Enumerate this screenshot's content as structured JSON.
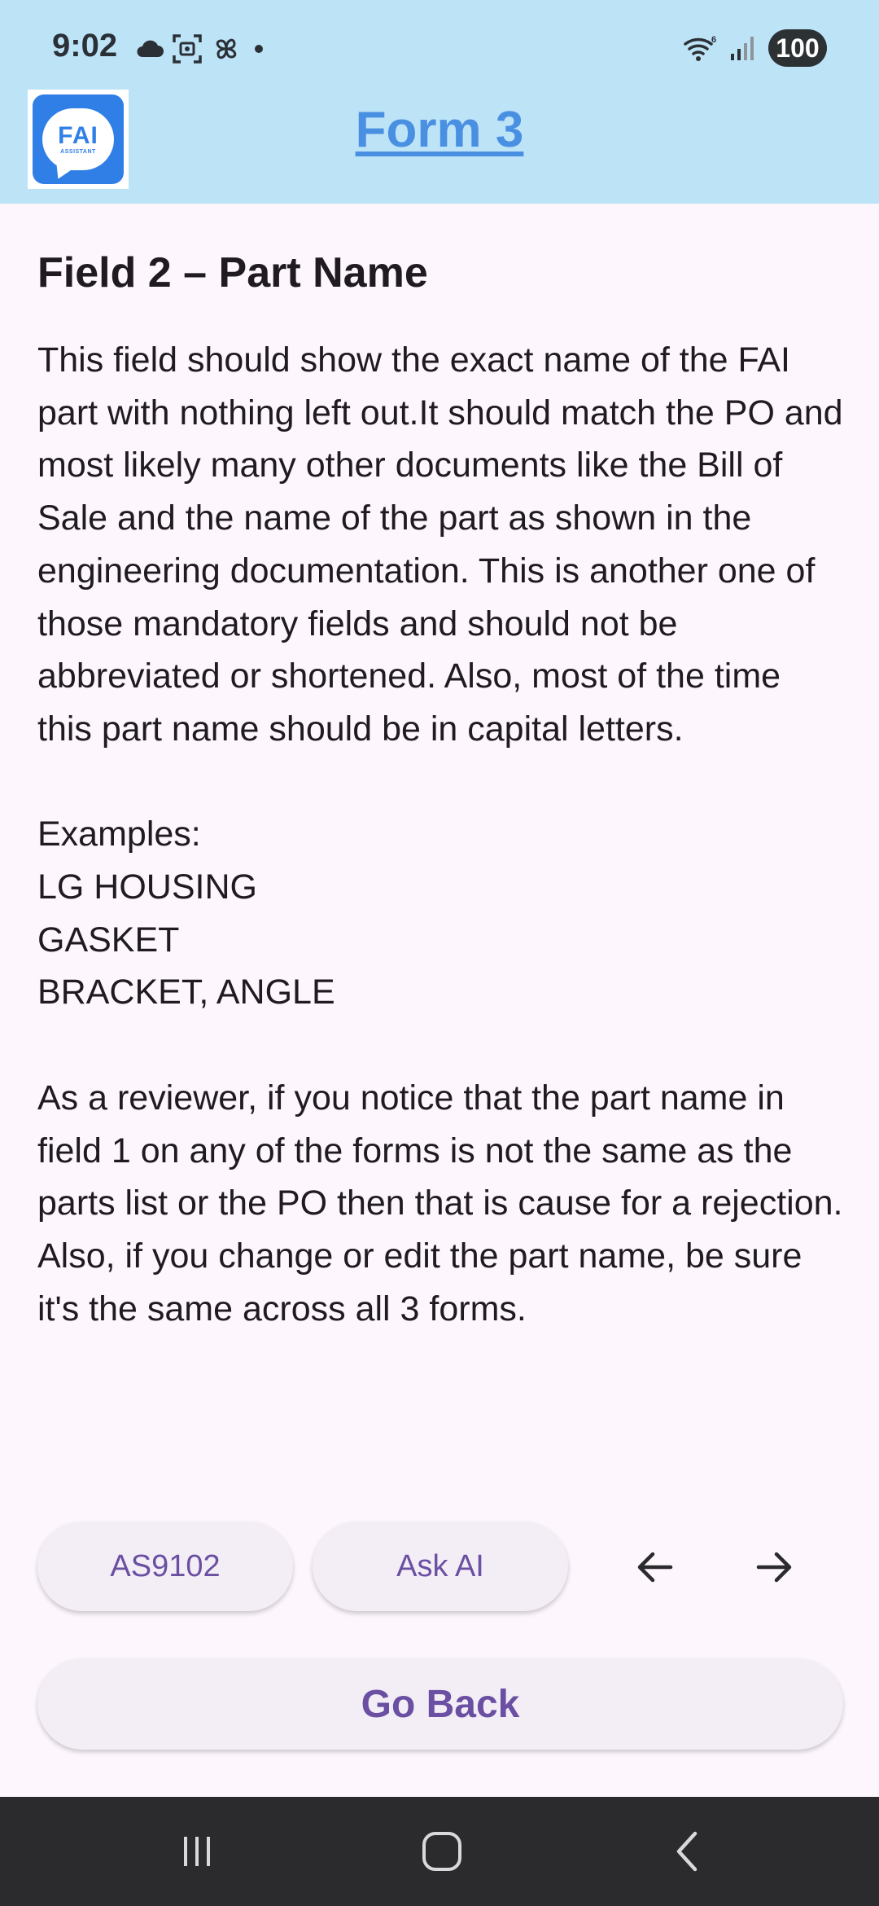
{
  "status_bar": {
    "time": "9:02",
    "battery": "100",
    "left_icons": [
      "cloud-icon",
      "screenshot-icon",
      "pinwheel-icon",
      "dot-icon"
    ],
    "right_icons": [
      "wifi-icon",
      "signal-icon"
    ]
  },
  "header": {
    "logo_text": "FAI",
    "logo_subtext": "ASSISTANT",
    "title": "Form 3",
    "background": "#bde3f7",
    "title_color": "#4a90e2"
  },
  "content": {
    "heading": "Field 2 – Part Name",
    "paragraph_1": "This field should show the exact name of the FAI part with nothing left out.It should match the PO and most likely many other documents like the Bill of Sale and the name of the part as shown in the engineering documentation. This is another one of those mandatory fields and should not be abbreviated or shortened. Also, most of the time this part name should be in capital letters.",
    "examples_label": "Examples:",
    "examples": [
      "LG HOUSING",
      "GASKET",
      "BRACKET, ANGLE"
    ],
    "paragraph_2": "As a reviewer, if you notice that the part name in field 1 on any of the forms is not the same as the parts list or the PO then that is cause for a rejection. Also, if you change or edit the part name, be sure it's the same across all 3 forms."
  },
  "actions": {
    "as9102_label": "AS9102",
    "ask_ai_label": "Ask AI",
    "prev_icon": "arrow-left-icon",
    "next_icon": "arrow-right-icon",
    "go_back_label": "Go Back",
    "button_text_color": "#6a4fa2"
  },
  "nav_bar": {
    "icons": [
      "recents-icon",
      "home-icon",
      "back-icon"
    ]
  }
}
